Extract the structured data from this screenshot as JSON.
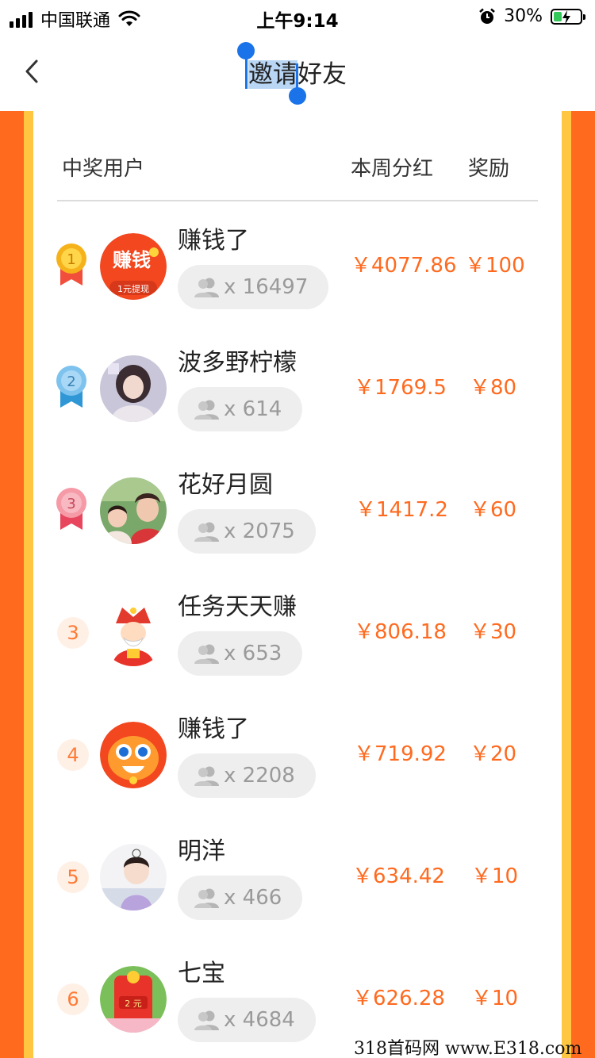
{
  "status_bar": {
    "carrier": "中国联通",
    "time": "上午9:14",
    "battery_percent": "30%",
    "battery_level": 0.3,
    "icons": [
      "signal-icon",
      "wifi-icon",
      "alarm-icon",
      "battery-charging-icon"
    ]
  },
  "nav": {
    "title_selected": "邀请",
    "title_rest": "好友",
    "back_icon": "chevron-left-icon"
  },
  "table": {
    "headers": {
      "user": "中奖用户",
      "dividend": "本周分红",
      "reward": "奖励"
    },
    "rows": [
      {
        "rank": "1",
        "rank_style": "gold-medal",
        "name": "赚钱了",
        "count": "x 16497",
        "dividend": "￥4077.86",
        "reward": "￥100",
        "avatar_text": "赚钱",
        "avatar_sub": "1元提现"
      },
      {
        "rank": "2",
        "rank_style": "silver-medal",
        "name": "波多野柠檬",
        "count": "x 614",
        "dividend": "￥1769.5",
        "reward": "￥80"
      },
      {
        "rank": "3",
        "rank_style": "bronze-medal",
        "name": "花好月圆",
        "count": "x 2075",
        "dividend": "￥1417.2",
        "reward": "￥60"
      },
      {
        "rank": "3",
        "rank_style": "circle",
        "name": "任务天天赚",
        "count": "x 653",
        "dividend": "￥806.18",
        "reward": "￥30"
      },
      {
        "rank": "4",
        "rank_style": "circle",
        "name": "赚钱了",
        "count": "x 2208",
        "dividend": "￥719.92",
        "reward": "￥20"
      },
      {
        "rank": "5",
        "rank_style": "circle",
        "name": "明洋",
        "count": "x 466",
        "dividend": "￥634.42",
        "reward": "￥10"
      },
      {
        "rank": "6",
        "rank_style": "circle",
        "name": "七宝",
        "count": "x 4684",
        "dividend": "￥626.28",
        "reward": "￥10",
        "avatar_text": "2 元"
      }
    ]
  },
  "colors": {
    "accent_orange": "#ff6a1f",
    "frame_yellow": "#ffc642",
    "selection_blue": "#1a73e8",
    "pill_bg": "#eeeeee"
  },
  "watermark": "318首码网 www.E318.com"
}
